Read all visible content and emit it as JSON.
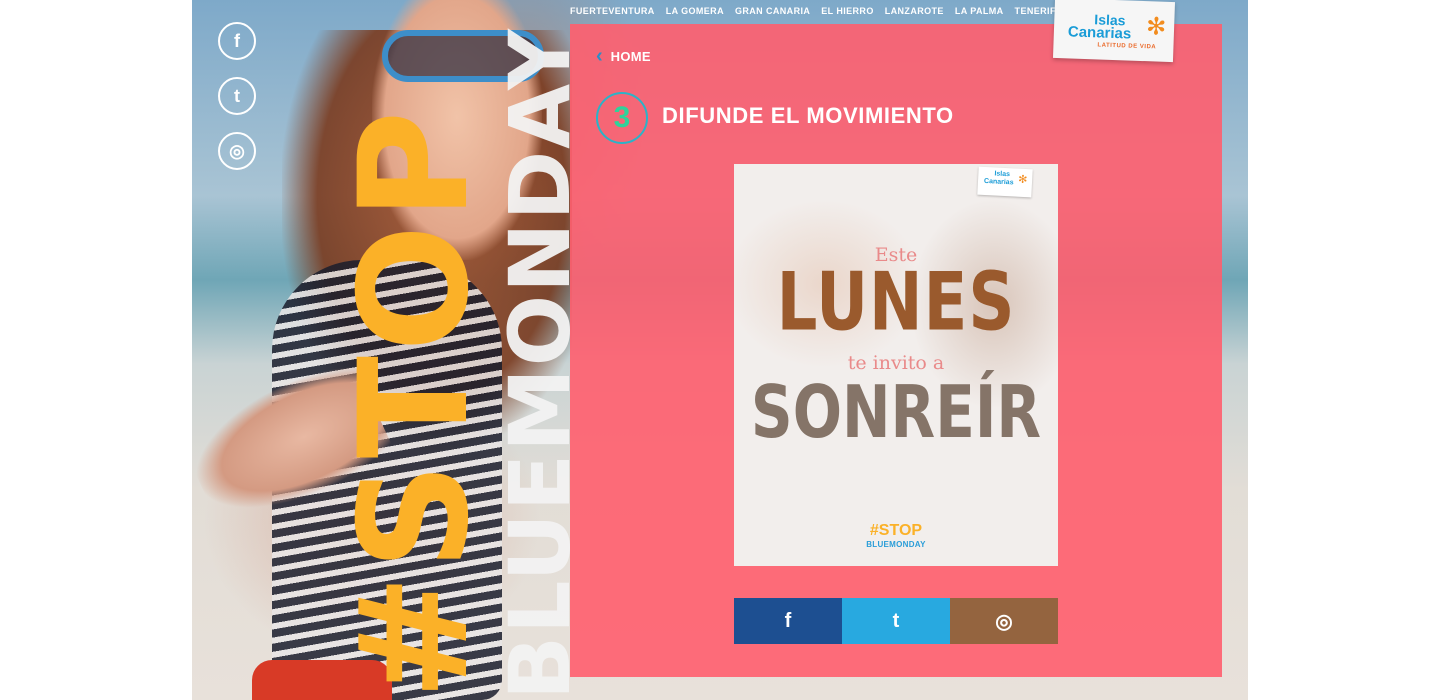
{
  "nav": {
    "items": [
      "FUERTEVENTURA",
      "LA GOMERA",
      "GRAN CANARIA",
      "EL HIERRO",
      "LANZAROTE",
      "LA PALMA",
      "TENERIFE"
    ]
  },
  "logo": {
    "line1": "Islas",
    "line2": "Canarias",
    "tagline": "LATITUD DE VIDA"
  },
  "headline": {
    "stop": "#STOP",
    "bluemonday": "BLUEMONDAY"
  },
  "social_left": [
    {
      "icon": "facebook-icon",
      "glyph": "f"
    },
    {
      "icon": "twitter-icon",
      "glyph": "t"
    },
    {
      "icon": "instagram-icon",
      "glyph": "◎"
    }
  ],
  "panel": {
    "home_label": "HOME",
    "step_number": "3",
    "step_title": "DIFUNDE EL MOVIMIENTO"
  },
  "poster": {
    "logo_line1": "Islas",
    "logo_line2": "Canarias",
    "este": "Este",
    "lunes": "LUNES",
    "invito": "te invito a",
    "sonreir": "SONREÍR",
    "stop": "#STOP",
    "bluemonday": "BLUEMONDAY"
  },
  "share": [
    {
      "network": "facebook",
      "icon": "facebook-icon",
      "glyph": "f",
      "color": "#1d4f91"
    },
    {
      "network": "twitter",
      "icon": "twitter-icon",
      "glyph": "t",
      "color": "#28a9e0"
    },
    {
      "network": "instagram",
      "icon": "instagram-icon",
      "glyph": "◎",
      "color": "#94643f"
    }
  ],
  "colors": {
    "panel_pink": "#ff5e6e",
    "stop_yellow": "#fbb128",
    "accent_blue": "#2a8dc8",
    "step_green": "#2fd39a"
  }
}
